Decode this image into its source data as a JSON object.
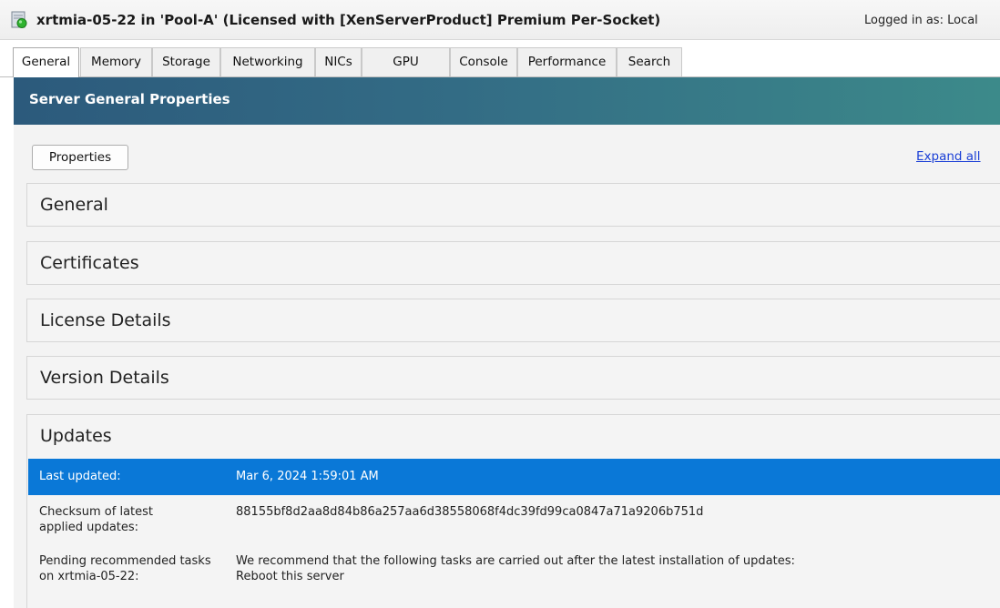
{
  "titlebar": {
    "title": "xrtmia-05-22 in 'Pool-A'   (Licensed with [XenServerProduct] Premium Per-Socket)",
    "logged_in": "Logged in as:  Local"
  },
  "tabs": [
    {
      "label": "General"
    },
    {
      "label": "Memory"
    },
    {
      "label": "Storage"
    },
    {
      "label": "Networking"
    },
    {
      "label": "NICs"
    },
    {
      "label": "GPU"
    },
    {
      "label": "Console"
    },
    {
      "label": "Performance"
    },
    {
      "label": "Search"
    }
  ],
  "active_tab": "General",
  "header": {
    "title": "Server General Properties"
  },
  "toolbar": {
    "properties_label": "Properties",
    "expand_all_label": "Expand all"
  },
  "sections": [
    {
      "label": "General"
    },
    {
      "label": "Certificates"
    },
    {
      "label": "License Details"
    },
    {
      "label": "Version Details"
    }
  ],
  "updates": {
    "title": "Updates",
    "rows": [
      {
        "label": "Last updated:",
        "value": "Mar 6, 2024 1:59:01 AM",
        "selected": true
      },
      {
        "label": "Checksum of latest applied updates:",
        "value": "88155bf8d2aa8d84b86a257aa6d38558068f4dc39fd99ca0847a71a9206b751d"
      },
      {
        "label": "Pending recommended tasks on xrtmia-05-22:",
        "value_line1": "We recommend that the following tasks are carried out after the latest installation of updates:",
        "value_line2": "Reboot this server"
      }
    ]
  },
  "icons": {
    "server": "server-running-icon"
  },
  "colors": {
    "header_start": "#2c5a7c",
    "header_end": "#3c8a8a",
    "selection": "#0a78d7",
    "link": "#1a3fd6",
    "status_green": "#2fb32f"
  }
}
